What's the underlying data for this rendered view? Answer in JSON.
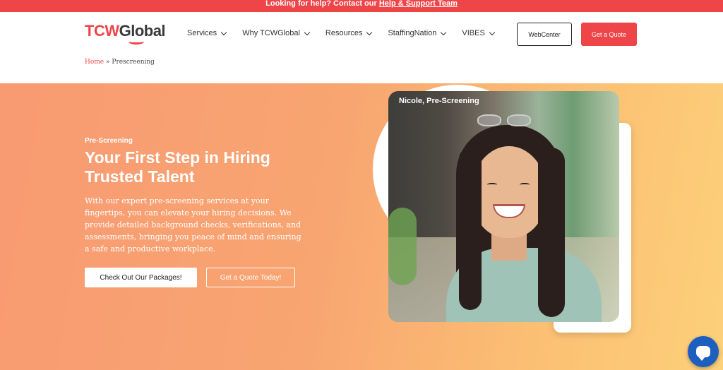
{
  "topbar": {
    "prefix": "Looking for help? Contact our ",
    "link": "Help & Support Team"
  },
  "header": {
    "logo": {
      "part1": "TCW",
      "part2": "Global"
    },
    "nav": [
      {
        "label": "Services"
      },
      {
        "label": "Why TCWGlobal"
      },
      {
        "label": "Resources"
      },
      {
        "label": "StaffingNation"
      },
      {
        "label": "VIBES"
      }
    ],
    "webcenter": "WebCenter",
    "quote": "Get a Quote"
  },
  "breadcrumb": {
    "home": "Home",
    "sep": "»",
    "current": "Prescreening"
  },
  "hero": {
    "eyebrow": "Pre-Screening",
    "title": "Your First Step in Hiring Trusted Talent",
    "description": "With our expert pre-screening services at your fingertips, you can elevate your hiring decisions. We provide detailed background checks, verifications, and assessments, bringing you peace of mind and ensuring a safe and productive workplace.",
    "primary_button": "Check Out Our Packages!",
    "secondary_button": "Get a Quote Today!",
    "photo_caption": "Nicole, Pre-Screening"
  },
  "colors": {
    "brand": "#ee4549",
    "chat": "#1d5fbf"
  },
  "icons": {
    "nav_chevron": "chevron-down-icon",
    "chat": "chat-icon"
  }
}
